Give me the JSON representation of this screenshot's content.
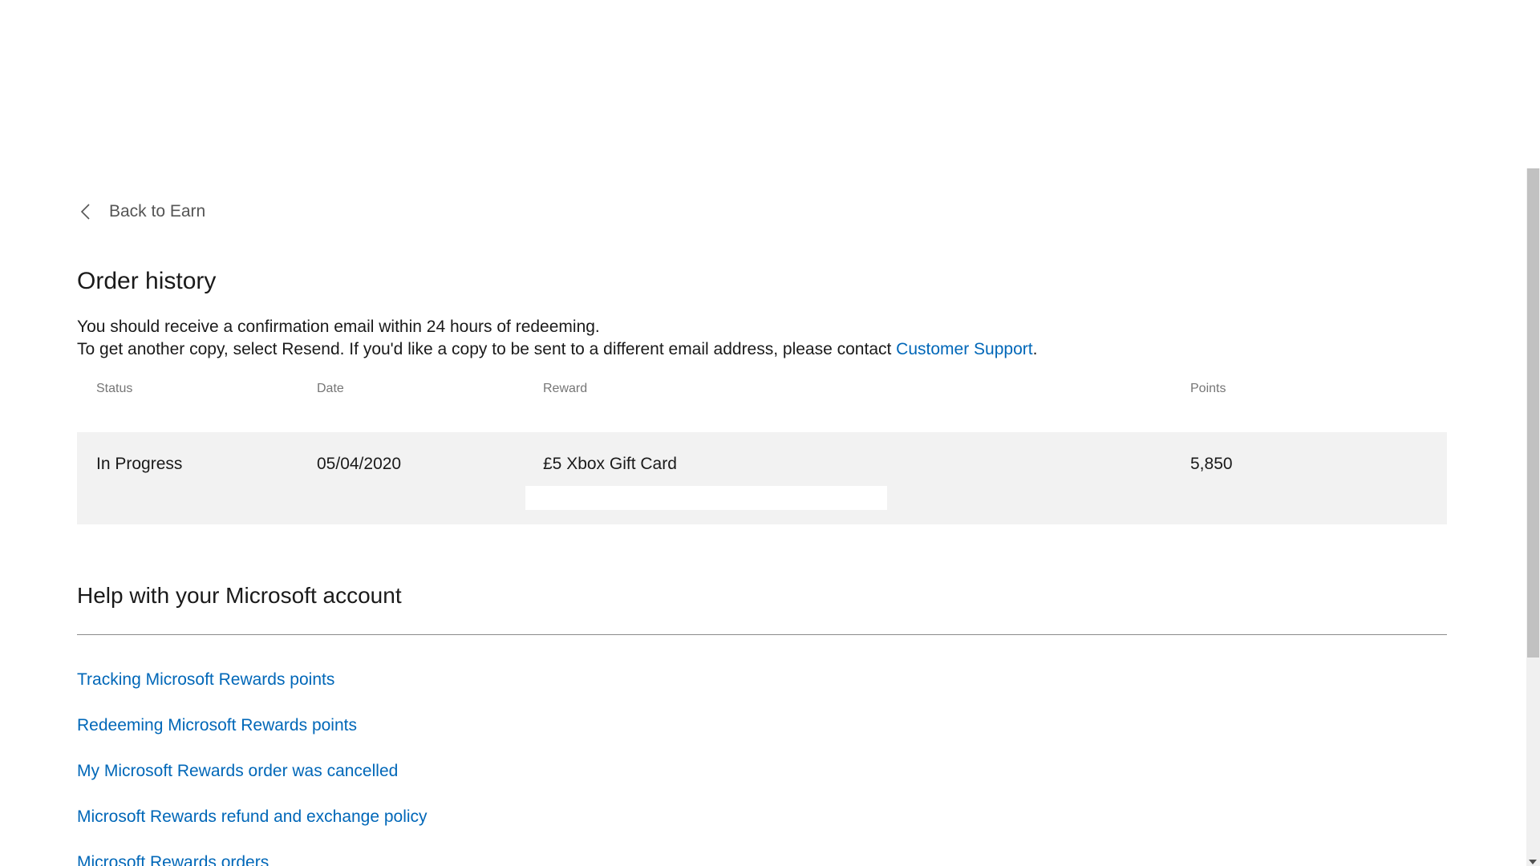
{
  "nav": {
    "back_label": "Back to Earn"
  },
  "page": {
    "title": "Order history",
    "description_line1": "You should receive a confirmation email within 24 hours of redeeming.",
    "description_line2": "To get another copy, select Resend. If you'd like a copy to be sent to a different email address, please contact ",
    "support_link": "Customer Support",
    "description_end": "."
  },
  "orders": {
    "headers": {
      "status": "Status",
      "date": "Date",
      "reward": "Reward",
      "points": "Points"
    },
    "rows": [
      {
        "status": "In Progress",
        "date": "05/04/2020",
        "reward": "£5 Xbox Gift Card",
        "points": "5,850"
      }
    ]
  },
  "help": {
    "title": "Help with your Microsoft account",
    "links": [
      "Tracking Microsoft Rewards points",
      "Redeeming Microsoft Rewards points",
      "My Microsoft Rewards order was cancelled",
      "Microsoft Rewards refund and exchange policy",
      "Microsoft Rewards orders"
    ]
  },
  "colors": {
    "link": "#0067b8",
    "row_background": "#f2f2f2",
    "text": "#1a1a1a",
    "muted": "#767676"
  }
}
